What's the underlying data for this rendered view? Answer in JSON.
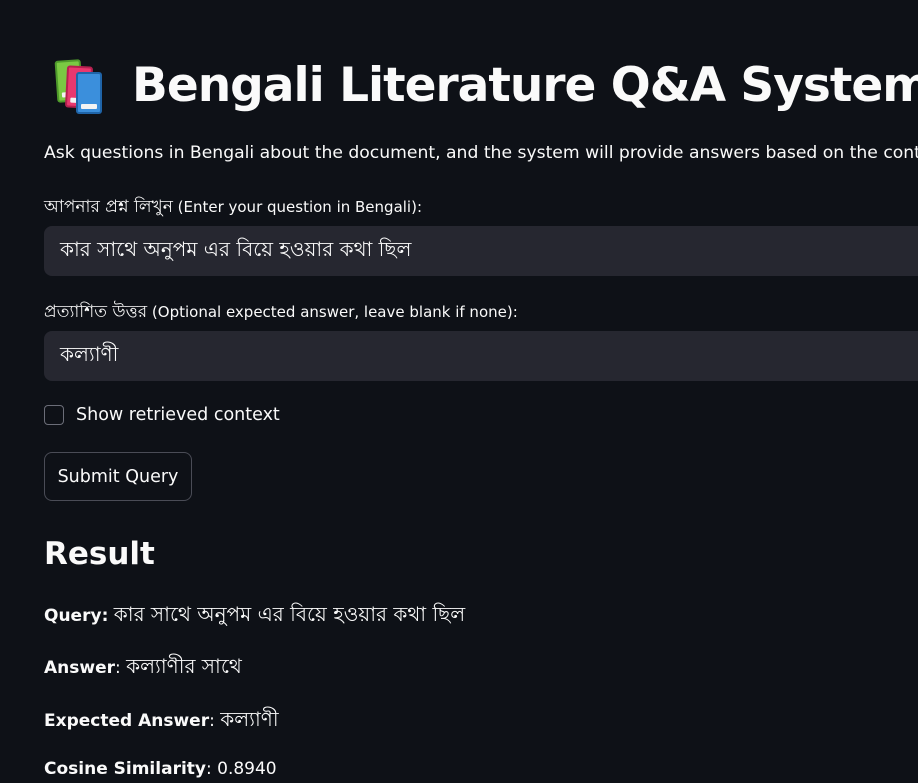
{
  "header": {
    "title": "Bengali Literature Q&A System",
    "icon": "books-icon",
    "subtitle": "Ask questions in Bengali about the document, and the system will provide answers based on the context."
  },
  "question_field": {
    "label_bn": "আপনার প্রশ্ন লিখুন",
    "label_en": "(Enter your question in Bengali):",
    "value": "কার সাথে অনুপম এর বিয়ে হওয়ার কথা ছিল"
  },
  "expected_field": {
    "label_bn": "প্রত্যাশিত উত্তর",
    "label_en": "(Optional expected answer, leave blank if none):",
    "value": "কল্যাণী"
  },
  "show_context": {
    "label": "Show retrieved context",
    "checked": false
  },
  "submit": {
    "label": "Submit Query"
  },
  "result": {
    "heading": "Result",
    "query_key": "Query",
    "query_value": "কার সাথে অনুপম এর বিয়ে হওয়ার কথা ছিল",
    "answer_key": "Answer",
    "answer_value": "কল্যাণীর সাথে",
    "expected_key": "Expected Answer",
    "expected_value": "কল্যাণী",
    "cosine_key": "Cosine Similarity",
    "cosine_value": "0.8940"
  },
  "colors": {
    "background": "#0e1117",
    "input_background": "#262730",
    "text": "#fafafa",
    "button_border": "#4a4c56"
  }
}
